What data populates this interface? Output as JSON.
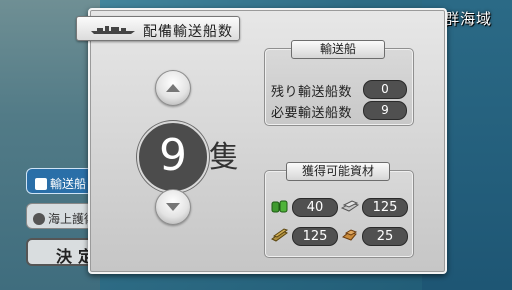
{
  "map": {
    "area_label": "群海域"
  },
  "side_menu": {
    "transport_label": "輸送船",
    "escort_label": "海上護衛",
    "decide_label": "決定"
  },
  "dialog": {
    "title": "配備輸送船数",
    "count": "9",
    "unit": "隻"
  },
  "transport_box": {
    "title": "輸送船",
    "rows": [
      {
        "label": "残り輸送船数",
        "value": "0"
      },
      {
        "label": "必要輸送船数",
        "value": "9"
      }
    ]
  },
  "resources_box": {
    "title": "獲得可能資材",
    "items": [
      {
        "icon": "fuel-barrels-icon",
        "value": "40",
        "color": "#3f9a2f"
      },
      {
        "icon": "steel-icon",
        "value": "125",
        "color": "#b9b9b9"
      },
      {
        "icon": "ammo-icon",
        "value": "125",
        "color": "#b09040"
      },
      {
        "icon": "bauxite-icon",
        "value": "25",
        "color": "#c88a3a"
      }
    ]
  }
}
